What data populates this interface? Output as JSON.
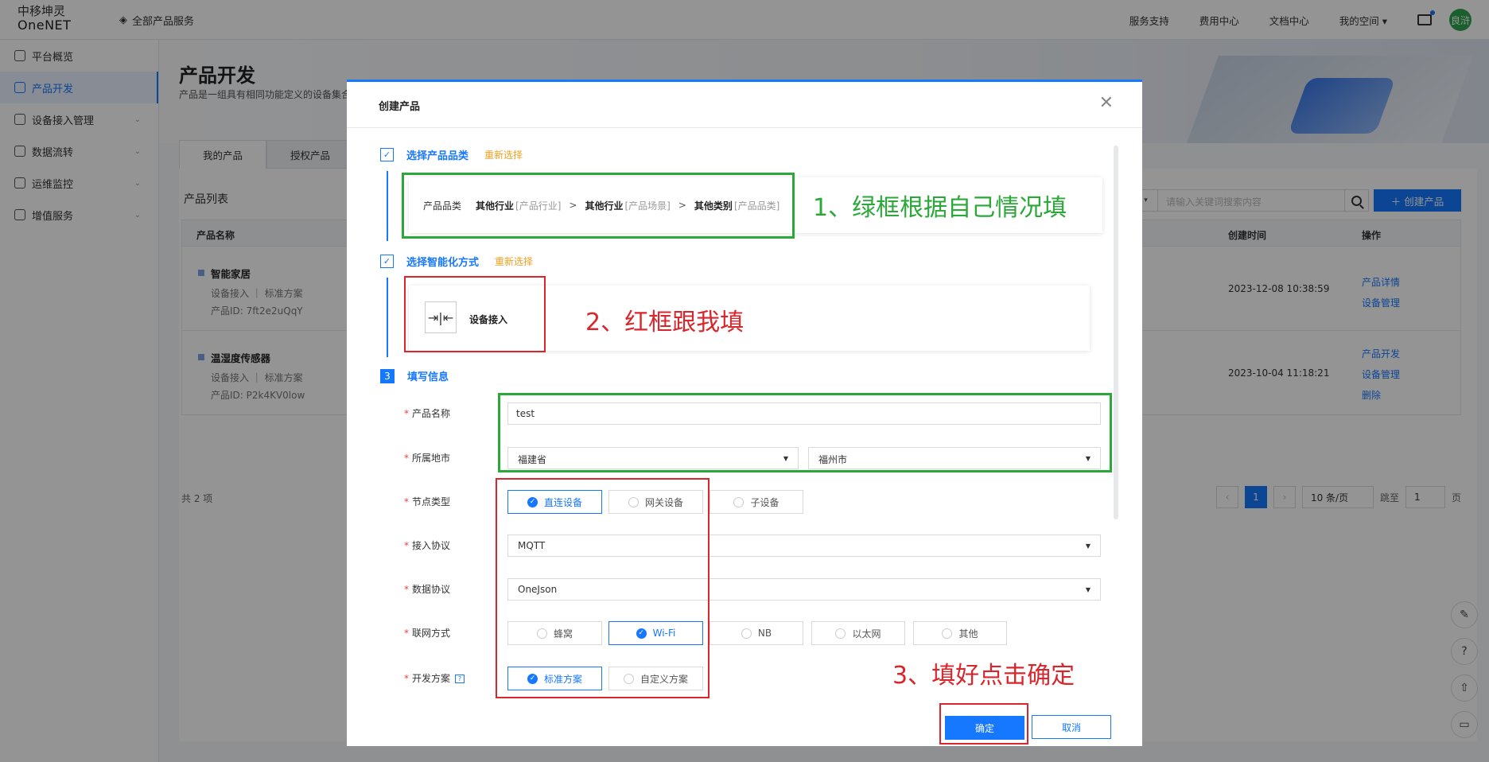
{
  "header": {
    "logo_line1": "中移坤灵",
    "logo_line2": "OneNET",
    "all_products": "全部产品服务",
    "nav": [
      "服务支持",
      "费用中心",
      "文档中心",
      "我的空间 ▾"
    ],
    "avatar": "良浒"
  },
  "sidebar": {
    "items": [
      {
        "label": "平台概览"
      },
      {
        "label": "产品开发"
      },
      {
        "label": "设备接入管理"
      },
      {
        "label": "数据流转"
      },
      {
        "label": "运维监控"
      },
      {
        "label": "增值服务"
      }
    ]
  },
  "page": {
    "title": "产品开发",
    "subtitle": "产品是一组具有相同功能定义的设备集合",
    "tabs": [
      "我的产品",
      "授权产品"
    ],
    "list_title": "产品列表",
    "search_placeholder": "请输入关键词搜索内容",
    "create_button": "＋ 创建产品",
    "columns": [
      "产品名称",
      "创建时间",
      "操作"
    ],
    "rows": [
      {
        "name": "智能家居",
        "scheme": "设备接入 ｜ 标准方案",
        "pid": "产品ID:  7ft2e2uQqY",
        "time": "2023-12-08 10:38:59",
        "ops": [
          "产品详情",
          "设备管理"
        ]
      },
      {
        "name": "温湿度传感器",
        "scheme": "设备接入 ｜ 标准方案",
        "pid": "产品ID:  P2k4KV0low",
        "time": "2023-10-04 11:18:21",
        "ops": [
          "产品开发",
          "设备管理",
          "删除"
        ]
      }
    ],
    "total": "共 2 项",
    "pager": {
      "current": "1",
      "size": "10 条/页",
      "jump_label": "跳至",
      "jump_value": "1",
      "page_suffix": "页"
    }
  },
  "modal": {
    "title": "创建产品",
    "step1": {
      "title": "选择产品品类",
      "reselect": "重新选择",
      "category_label": "产品品类",
      "cat1": "其他行业",
      "cat1_hint": "[产品行业]",
      "cat2": "其他行业",
      "cat2_hint": "[产品场景]",
      "cat3": "其他类别",
      "cat3_hint": "[产品品类]"
    },
    "step2": {
      "title": "选择智能化方式",
      "reselect": "重新选择",
      "method": "设备接入"
    },
    "step3": {
      "number": "3",
      "title": "填写信息"
    },
    "fields": {
      "name": {
        "label": "产品名称",
        "value": "test"
      },
      "region": {
        "label": "所属地市",
        "province": "福建省",
        "city": "福州市"
      },
      "node_type": {
        "label": "节点类型",
        "options": [
          "直连设备",
          "网关设备",
          "子设备"
        ],
        "selected": 0
      },
      "protocol": {
        "label": "接入协议",
        "value": "MQTT"
      },
      "data_protocol": {
        "label": "数据协议",
        "value": "OneJson"
      },
      "network": {
        "label": "联网方式",
        "options": [
          "蜂窝",
          "Wi-Fi",
          "NB",
          "以太网",
          "其他"
        ],
        "selected": 1
      },
      "dev_plan": {
        "label": "开发方案",
        "options": [
          "标准方案",
          "自定义方案"
        ],
        "selected": 0
      }
    },
    "ok": "确定",
    "cancel": "取消"
  },
  "annotations": {
    "a1": "1、绿框根据自己情况填",
    "a2": "2、红框跟我填",
    "a3": "3、填好点击确定",
    "green": "#2aa838",
    "red": "#d9262c"
  }
}
